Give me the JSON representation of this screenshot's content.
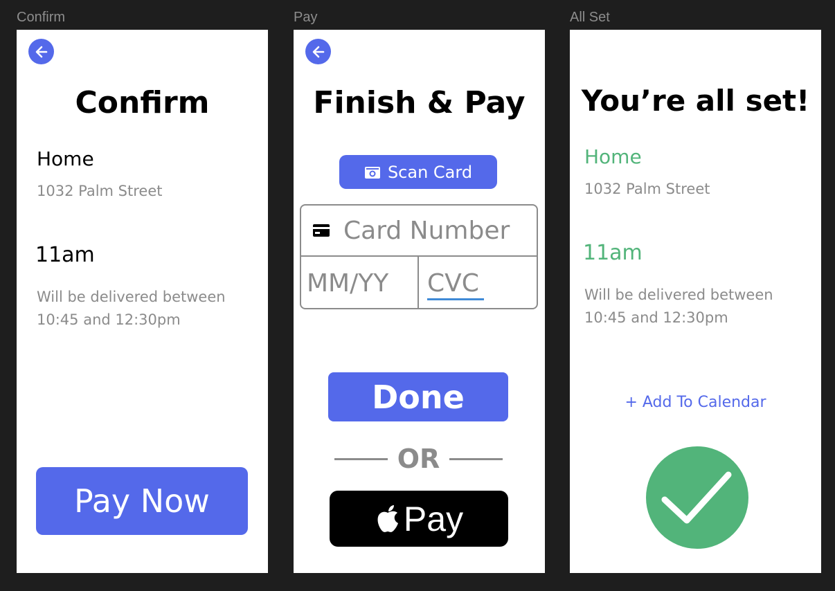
{
  "frames": {
    "confirm": {
      "label": "Confirm",
      "title": "Confirm",
      "address_name": "Home",
      "address_line": "1032 Palm Street",
      "time": "11am",
      "delivery_note_line1": "Will be delivered between",
      "delivery_note_line2": "10:45 and 12:30pm",
      "pay_button": "Pay Now"
    },
    "pay": {
      "label": "Pay",
      "title": "Finish & Pay",
      "scan_button": "Scan Card",
      "card_number_placeholder": "Card Number",
      "expiry_placeholder": "MM/YY",
      "cvc_placeholder": "CVC",
      "done_button": "Done",
      "or_text": "OR",
      "apple_pay_text": "Pay"
    },
    "all_set": {
      "label": "All Set",
      "title": "You’re all set!",
      "address_name": "Home",
      "address_line": "1032 Palm Street",
      "time": "11am",
      "delivery_note_line1": "Will be delivered between",
      "delivery_note_line2": "10:45 and 12:30pm",
      "calendar_link": "+ Add To Calendar"
    }
  },
  "colors": {
    "accent": "#5469ea",
    "success": "#52b47a",
    "muted_text": "#8b8b8b",
    "canvas": "#1e1e1e"
  },
  "icons": {
    "back": "arrow-left-icon",
    "scan": "camera-icon",
    "card": "credit-card-icon",
    "apple": "apple-logo-icon",
    "success": "checkmark-icon"
  }
}
